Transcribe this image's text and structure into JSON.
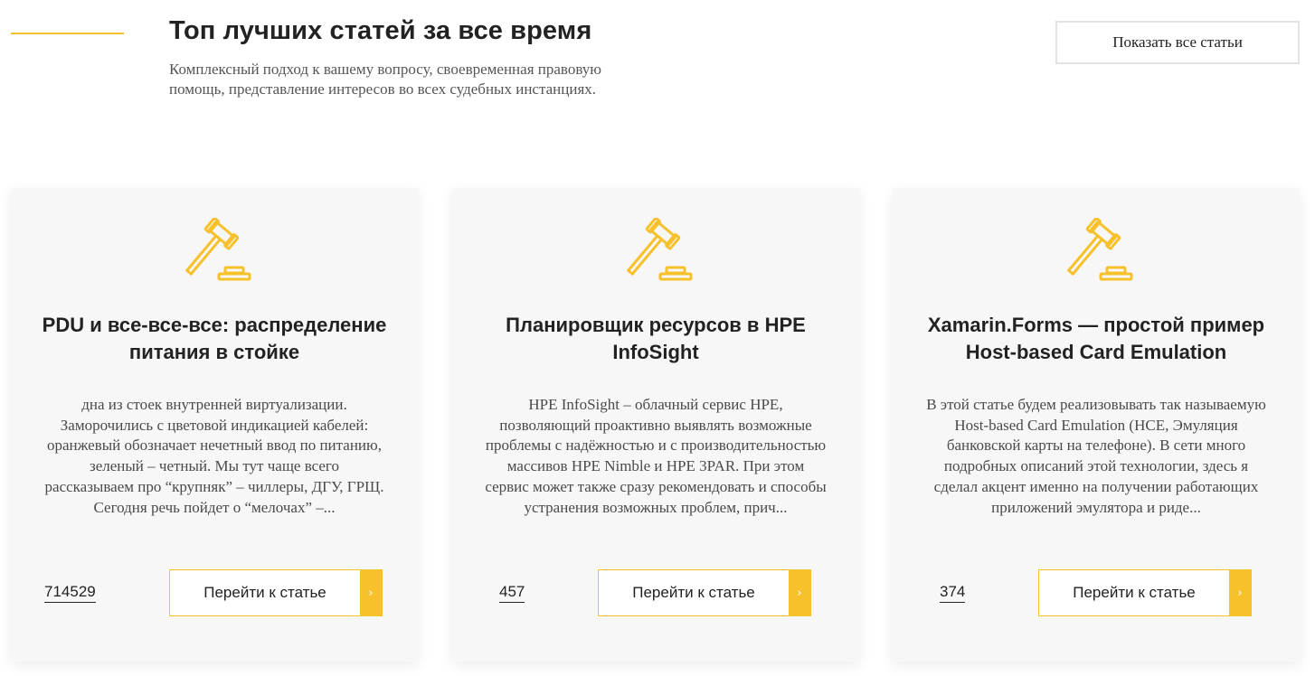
{
  "header": {
    "title": "Топ лучших статей за все время",
    "subtitle": "Комплексный подход к вашему вопросу, своевременная правовую помощь, представление интересов во всех судебных инстанциях.",
    "show_all_label": "Показать все статьи"
  },
  "colors": {
    "accent": "#f6c12b",
    "card_bg": "#f7f7f7"
  },
  "cards": [
    {
      "icon": "gavel-icon",
      "title": "PDU и все-все-все: распределение питания в стойке",
      "text": "дна из стоек внутренней виртуализации. Заморочились с цветовой индикацией кабелей: оранжевый обозначает нечетный ввод по питанию, зеленый – четный. Мы тут чаще всего рассказываем про “крупняк” – чиллеры, ДГУ, ГРЩ. Сегодня речь пойдет о “мелочах” –...",
      "count": "714529",
      "button_label": "Перейти к статье",
      "arrow": "›"
    },
    {
      "icon": "gavel-icon",
      "title": "Планировщик ресурсов в HPE InfoSight",
      "text": "HPE InfoSight – облачный сервис HPE, позволяющий проактивно выявлять возможные проблемы с надёжностью и с производительностью массивов HPE Nimble и HPE 3PAR. При этом сервис может также сразу рекомендовать и способы устранения возможных проблем, прич...",
      "count": "457",
      "button_label": "Перейти к статье",
      "arrow": "›"
    },
    {
      "icon": "gavel-icon",
      "title": "Xamarin.Forms — простой пример Host-based Card Emulation",
      "text": "В этой статье будем реализовывать так называемую Host-based Card Emulation (HCE, Эмуляция банковской карты на телефоне). В сети много подробных описаний этой технологии, здесь я сделал акцент именно на получении работающих приложений эмулятора и риде...",
      "count": "374",
      "button_label": "Перейти к статье",
      "arrow": "›"
    }
  ]
}
